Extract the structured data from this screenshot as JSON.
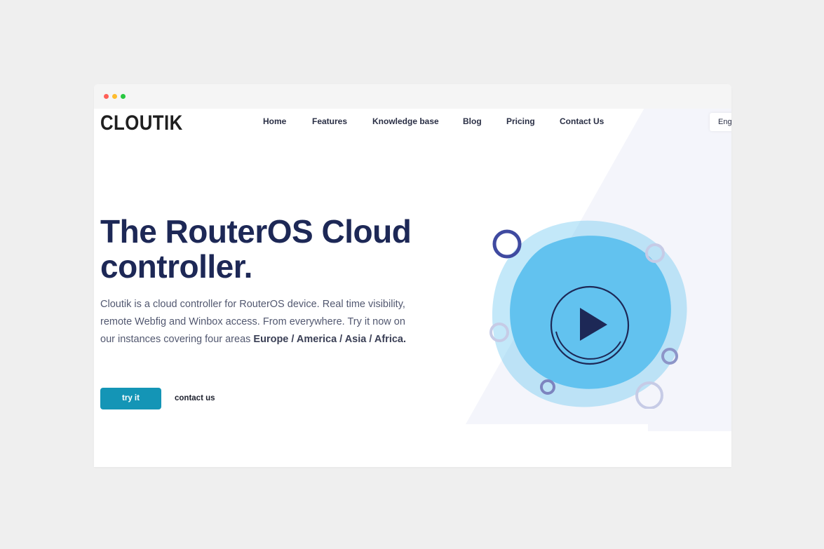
{
  "brand": {
    "logo": "CLOUTIK"
  },
  "nav": {
    "items": [
      {
        "label": "Home"
      },
      {
        "label": "Features"
      },
      {
        "label": "Knowledge base"
      },
      {
        "label": "Blog"
      },
      {
        "label": "Pricing"
      },
      {
        "label": "Contact Us"
      }
    ],
    "language": "Eng"
  },
  "hero": {
    "title_line1": "The RouterOS Cloud",
    "title_line2": "controller.",
    "text_part1": "Cloutik is a cloud controller for RouterOS device. Real time visibility, remote Webfig and Winbox access. From everywhere. Try it now on our instances covering four areas ",
    "text_bold": "Europe / America / Asia / Africa.",
    "try_label": "try it",
    "contact_label": "contact us"
  },
  "media": {
    "play_icon": "play-icon",
    "colors": {
      "blob": "#62c2ef",
      "ring_dark": "#3f4aa0",
      "ring_light": "#c6cbe6",
      "play": "#1d2856"
    }
  },
  "colors": {
    "accent": "#1495b6",
    "heading": "#1d2856"
  }
}
